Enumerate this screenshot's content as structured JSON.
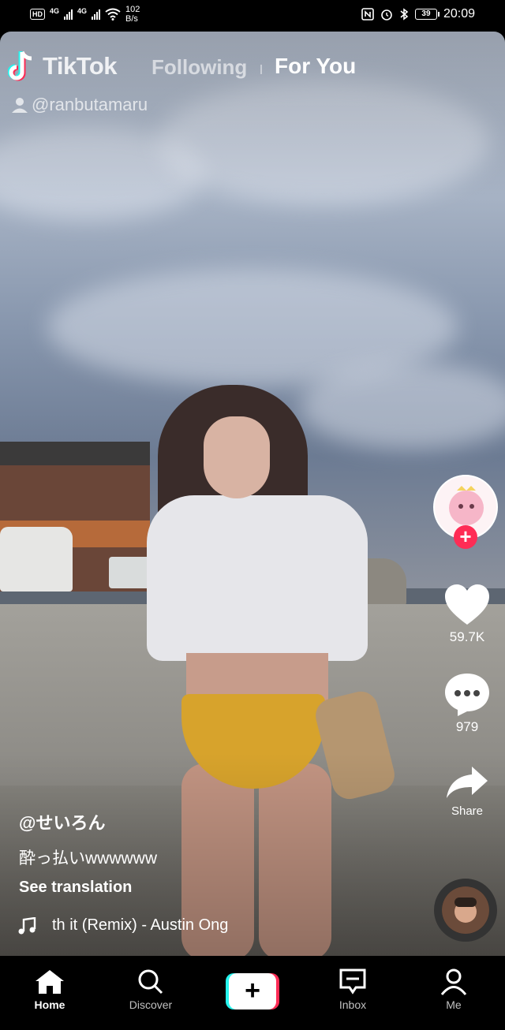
{
  "status_bar": {
    "hd": "HD",
    "network1": "4G",
    "network2": "4G",
    "speed_value": "102",
    "speed_unit": "B/s",
    "battery": "39",
    "time": "20:09"
  },
  "top_nav": {
    "app_name": "TikTok",
    "tab_following": "Following",
    "tab_for_you": "For You",
    "creator_handle": "@ranbutamaru"
  },
  "actions": {
    "likes": "59.7K",
    "comments": "979",
    "share": "Share"
  },
  "caption": {
    "author": "@せいろん",
    "description": "酔っ払いwwwwww",
    "see_translation": "See translation",
    "music": "th it (Remix) - Austin Ong"
  },
  "bottom_nav": {
    "home": "Home",
    "discover": "Discover",
    "create": "+",
    "inbox": "Inbox",
    "me": "Me"
  },
  "colors": {
    "accent_red": "#fe2c55",
    "accent_cyan": "#25f4ee"
  }
}
